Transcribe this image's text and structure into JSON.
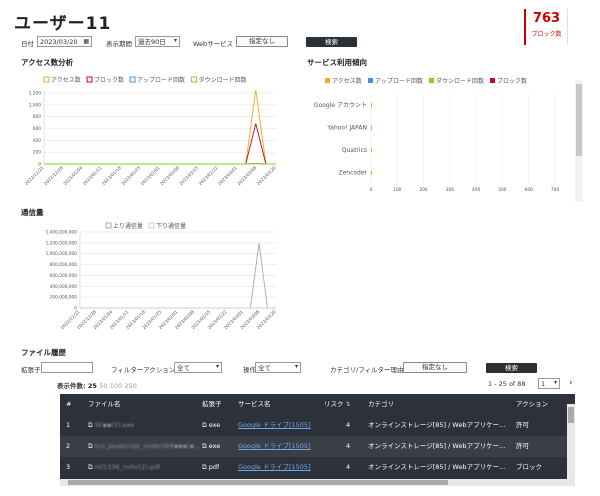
{
  "header": {
    "title": "ユーザー11",
    "block_count": "763",
    "block_label": "ブロック数"
  },
  "filters": {
    "date_label": "日付",
    "date_value": "2023/03/20",
    "period_label": "表示期間",
    "period_value": "過去90日",
    "web_label": "Webサービス",
    "web_value": "指定なし",
    "search_label": "検索"
  },
  "access_chart_section": "アクセス数分析",
  "service_chart_section": "サービス利用傾向",
  "traffic_chart_section": "通信量",
  "chart_data": [
    {
      "type": "line",
      "series": [
        {
          "name": "アクセス数",
          "color": "#f5a623",
          "values": [
            0,
            0,
            0,
            0,
            0,
            0,
            0,
            0,
            0,
            0,
            0,
            0,
            0,
            0,
            0,
            0,
            0,
            0,
            0,
            0,
            0,
            1250,
            0,
            0
          ]
        },
        {
          "name": "ブロック数",
          "color": "#d0021b",
          "values": [
            0,
            0,
            0,
            0,
            0,
            0,
            0,
            0,
            0,
            0,
            0,
            0,
            0,
            0,
            0,
            0,
            0,
            0,
            0,
            0,
            0,
            680,
            0,
            0
          ]
        },
        {
          "name": "アップロード回数",
          "color": "#4a90e2",
          "values": [
            0,
            0,
            0,
            0,
            0,
            0,
            0,
            0,
            0,
            0,
            0,
            0,
            0,
            0,
            0,
            0,
            0,
            0,
            0,
            0,
            0,
            10,
            0,
            0
          ]
        },
        {
          "name": "ダウンロード回数",
          "color": "#7ed321",
          "values": [
            0,
            0,
            0,
            0,
            0,
            0,
            0,
            0,
            0,
            0,
            0,
            0,
            0,
            0,
            0,
            0,
            0,
            0,
            0,
            0,
            0,
            5,
            0,
            0
          ]
        }
      ],
      "y_ticks": [
        "0",
        "200",
        "400",
        "600",
        "800",
        "1,000",
        "1,200"
      ],
      "ylim": [
        0,
        1250
      ],
      "x_ticks": [
        "2022/12/21",
        "2022/12/28",
        "2023/01/04",
        "2023/01/11",
        "2023/01/18",
        "2023/01/25",
        "2023/02/01",
        "2023/02/08",
        "2023/02/15",
        "2023/02/22",
        "2023/03/01",
        "2023/03/08",
        "2023/03/20"
      ]
    },
    {
      "type": "bar",
      "orientation": "horizontal",
      "legend": [
        {
          "name": "アクセス数",
          "color": "#f5a623"
        },
        {
          "name": "アップロード回数",
          "color": "#4a90e2"
        },
        {
          "name": "ダウンロード回数",
          "color": "#7ed321"
        },
        {
          "name": "ブロック数",
          "color": "#d0021b"
        }
      ],
      "categories": [
        "Google アカウント",
        "Yahoo! JAPAN",
        "Quatrics",
        "Zencoder"
      ],
      "values": [
        3,
        2,
        2,
        4
      ],
      "x_ticks": [
        "0",
        "100",
        "200",
        "300",
        "400",
        "500",
        "600",
        "700"
      ],
      "xlim": [
        0,
        700
      ]
    },
    {
      "type": "line",
      "series": [
        {
          "name": "上り通信量",
          "color": "#aaaaaa",
          "values": [
            0,
            0,
            0,
            0,
            0,
            0,
            0,
            0,
            0,
            0,
            0,
            0,
            0,
            0,
            0,
            0,
            0,
            0,
            0,
            0,
            0,
            1200000000,
            0,
            0
          ]
        },
        {
          "name": "下り通信量",
          "color": "#cccccc",
          "values": [
            0,
            0,
            0,
            0,
            0,
            0,
            0,
            0,
            0,
            0,
            0,
            0,
            0,
            0,
            0,
            0,
            0,
            0,
            0,
            0,
            0,
            0,
            0,
            0
          ]
        }
      ],
      "y_ticks": [
        "0",
        "200,000,000",
        "400,000,000",
        "600,000,000",
        "800,000,000",
        "1,000,000,000",
        "1,200,000,000",
        "1,400,000,000"
      ],
      "ylim": [
        0,
        1400000000
      ],
      "x_ticks": [
        "2022/12/21",
        "2022/12/28",
        "2023/01/04",
        "2023/01/11",
        "2023/01/18",
        "2023/01/25",
        "2023/02/01",
        "2023/02/08",
        "2023/02/15",
        "2023/02/22",
        "2023/03/01",
        "2023/03/08",
        "2023/03/20"
      ]
    }
  ],
  "file_history": {
    "section": "ファイル履歴",
    "ext_label": "拡張子",
    "filter_action_label": "フィルターアクション",
    "filter_action_value": "全て",
    "op_label": "操作",
    "op_value": "全て",
    "cat_label": "カテゴリ/フィルター理由",
    "cat_value": "指定なし",
    "search_label": "検索",
    "count_label": "表示件数:",
    "counts": [
      "25",
      "50",
      "100",
      "250"
    ],
    "range": "1 - 25 of 88",
    "page": "1",
    "next": "›",
    "columns": [
      "#",
      "ファイル名",
      "拡張子",
      "サービス名",
      "リスク",
      "カテゴリ",
      "アクション"
    ],
    "rows": [
      {
        "no": "1",
        "file": "SF▪▪(3).exe",
        "ext": "exe",
        "service": "Google ドライブ[1505]",
        "risk": "4",
        "category": "オンラインストレージ[85] / Webアプリケー...",
        "action": "許可"
      },
      {
        "no": "2",
        "file": "rco_javascript_underlib9▪▪▪(▪...",
        "ext": "exe",
        "service": "Google ドライブ[1505]",
        "risk": "4",
        "category": "オンラインストレージ[85] / Webアプリケー...",
        "action": "許可"
      },
      {
        "no": "3",
        "file": "rol1336_rothr(2).pdf",
        "ext": "pdf",
        "service": "Google ドライブ[1505]",
        "risk": "4",
        "category": "オンラインストレージ[85] / Webアプリケー...",
        "action": "ブロック"
      }
    ]
  }
}
